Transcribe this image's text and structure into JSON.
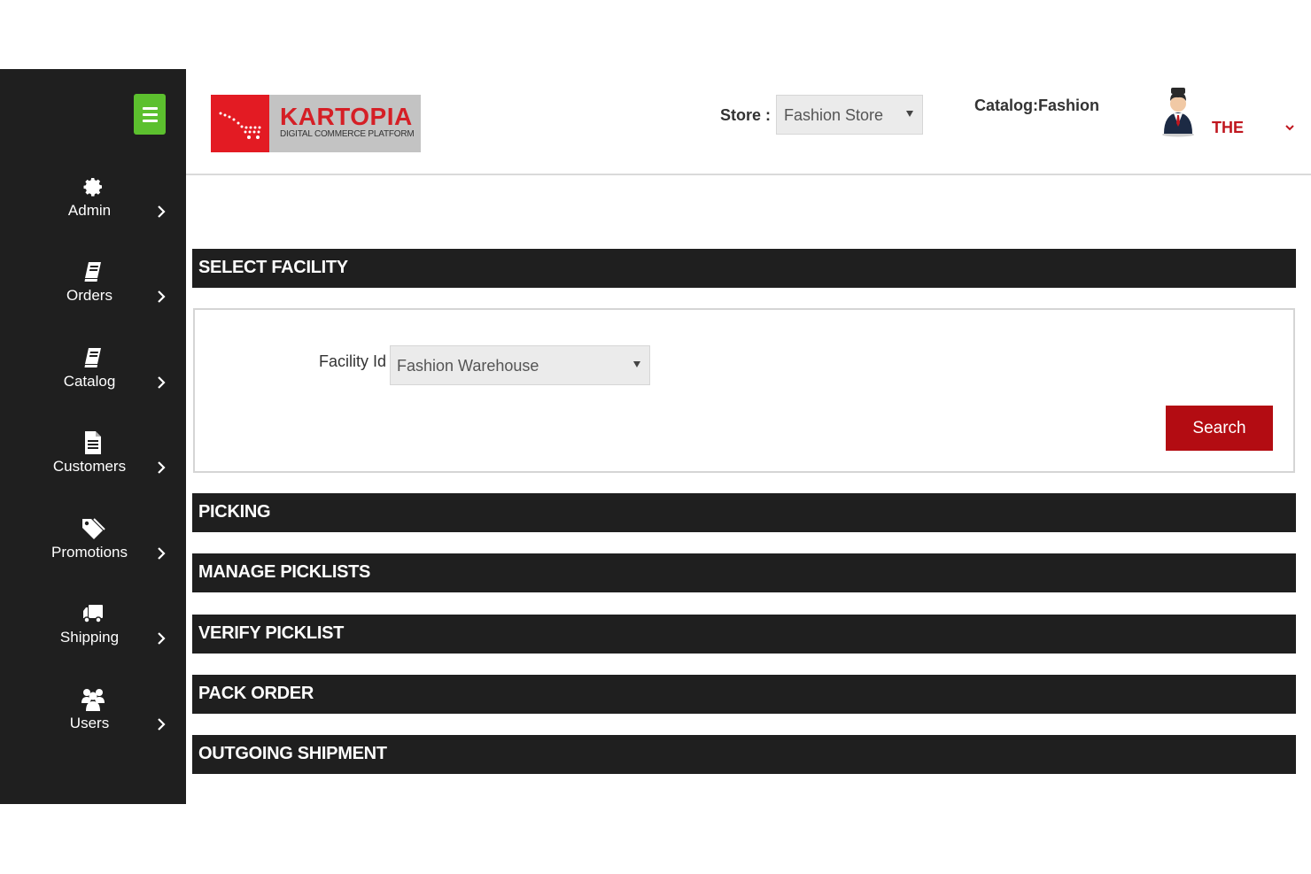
{
  "sidebar": {
    "items": [
      {
        "label": "Admin",
        "icon": "gear-icon"
      },
      {
        "label": "Orders",
        "icon": "book-icon"
      },
      {
        "label": "Catalog",
        "icon": "book-icon"
      },
      {
        "label": "Customers",
        "icon": "document-icon"
      },
      {
        "label": "Promotions",
        "icon": "tags-icon"
      },
      {
        "label": "Shipping",
        "icon": "truck-icon"
      },
      {
        "label": "Users",
        "icon": "users-icon"
      }
    ]
  },
  "header": {
    "logo": {
      "title": "KARTOPIA",
      "subtitle": "DIGITAL COMMERCE PLATFORM"
    },
    "store_label": "Store :",
    "store_value": "Fashion Store",
    "catalog_label": "Catalog:",
    "catalog_value": "Fashion",
    "user_name": "THE"
  },
  "sections": {
    "select_facility": "SELECT FACILITY",
    "picking": "PICKING",
    "manage_picklists": "MANAGE PICKLISTS",
    "verify_picklist": "VERIFY PICKLIST",
    "pack_order": "PACK ORDER",
    "outgoing_shipment": "OUTGOING SHIPMENT"
  },
  "facility_form": {
    "label": "Facility Id",
    "value": "Fashion Warehouse",
    "search_label": "Search"
  },
  "colors": {
    "sidebar_bg": "#1f1f1f",
    "toggle_green": "#5cc02e",
    "brand_red": "#e31b23",
    "button_red": "#b30c12"
  }
}
